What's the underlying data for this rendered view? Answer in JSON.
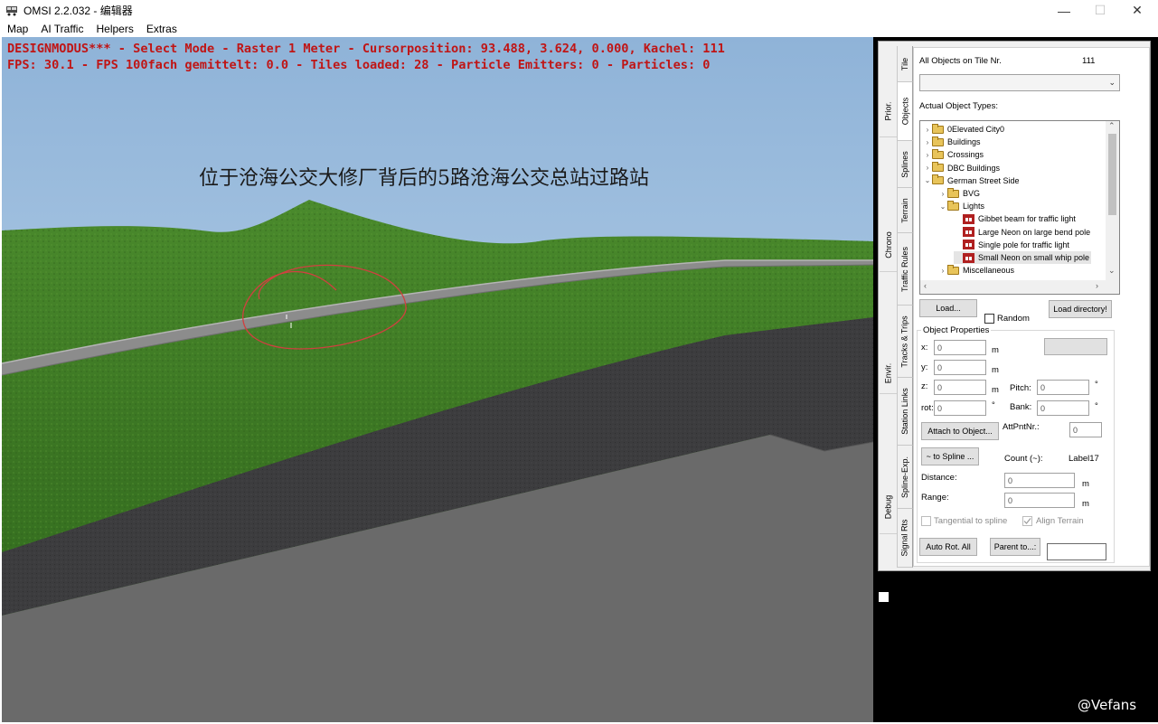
{
  "window": {
    "title": "OMSI 2.2.032 - 编辑器",
    "controls": {
      "minimize": "—",
      "maximize": "☐",
      "close": "✕"
    }
  },
  "menu": [
    "Map",
    "AI Traffic",
    "Helpers",
    "Extras"
  ],
  "viewport": {
    "hud_line1": "DESIGNMODUS*** - Select Mode - Raster 1 Meter - Cursorposition: 93.488, 3.624, 0.000, Kachel: 111",
    "hud_line2": "FPS: 30.1 - FPS 100fach gemittelt: 0.0 - Tiles loaded: 28 - Particle Emitters: 0 - Particles: 0",
    "caption": "位于沧海公交大修厂背后的5路沧海公交总站过路站",
    "colors": {
      "sky": "#a9c8e4",
      "grass": "#3e7a26",
      "road": "#8c8c8c",
      "asphalt": "#3c3c3e",
      "concrete": "#6a6a6a",
      "annotation": "#d04040"
    }
  },
  "panel": {
    "outer_tabs": [
      "Prior.",
      "Chrono",
      "Envir.",
      "Debug"
    ],
    "inner_tabs": [
      "Tile",
      "Objects",
      "Splines",
      "Terrain",
      "Traffic Rules",
      "Tracks & Trips",
      "Station Links",
      "Spline-Exp.",
      "Signal Rts"
    ],
    "all_objects_label": "All Objects on Tile Nr.",
    "tile_number": "111",
    "actual_types_label": "Actual Object Types:",
    "tree": [
      {
        "label": "0Elevated City0",
        "depth": 0,
        "caret": "›",
        "icon": "folder"
      },
      {
        "label": "Buildings",
        "depth": 0,
        "caret": "›",
        "icon": "folder"
      },
      {
        "label": "Crossings",
        "depth": 0,
        "caret": "›",
        "icon": "folder"
      },
      {
        "label": "DBC Buildings",
        "depth": 0,
        "caret": "›",
        "icon": "folder"
      },
      {
        "label": "German Street Side",
        "depth": 0,
        "caret": "⌄",
        "icon": "folder"
      },
      {
        "label": "BVG",
        "depth": 1,
        "caret": "›",
        "icon": "folder"
      },
      {
        "label": "Lights",
        "depth": 1,
        "caret": "⌄",
        "icon": "folder"
      },
      {
        "label": "Gibbet beam for traffic light",
        "depth": 2,
        "caret": "",
        "icon": "house"
      },
      {
        "label": "Large Neon on large bend pole",
        "depth": 2,
        "caret": "",
        "icon": "house"
      },
      {
        "label": "Single pole for traffic light",
        "depth": 2,
        "caret": "",
        "icon": "house"
      },
      {
        "label": "Small Neon on small whip pole",
        "depth": 2,
        "caret": "",
        "icon": "house",
        "selected": true
      },
      {
        "label": "Miscellaneous",
        "depth": 1,
        "caret": "›",
        "icon": "folder"
      }
    ],
    "load_button": "Load...",
    "random_label": "Random",
    "load_directory_button": "Load directory!",
    "object_properties_label": "Object Properties",
    "fields": {
      "x_label": "x:",
      "x_value": "0",
      "y_label": "y:",
      "y_value": "0",
      "z_label": "z:",
      "z_value": "0",
      "rot_label": "rot:",
      "rot_value": "0",
      "pitch_label": "Pitch:",
      "pitch_value": "0",
      "bank_label": "Bank:",
      "bank_value": "0",
      "unit_m": "m",
      "unit_deg": "°"
    },
    "attach_button": "Attach to Object...",
    "attpnt_label": "AttPntNr.:",
    "attpnt_value": "0",
    "to_spline_button": "~ to Spline ...",
    "count_label": "Count (~):",
    "label17": "Label17",
    "distance_label": "Distance:",
    "distance_value": "0",
    "range_label": "Range:",
    "range_value": "0",
    "tangential_label": "Tangential to spline",
    "align_terrain_label": "Align Terrain",
    "auto_rot_button": "Auto Rot. All",
    "parent_button": "Parent to...:"
  },
  "watermark": "@Vefans"
}
